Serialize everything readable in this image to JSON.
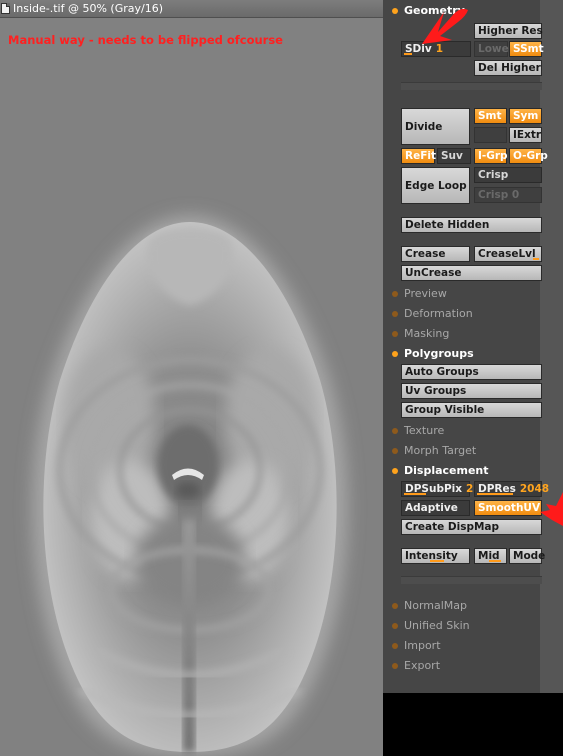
{
  "window": {
    "title": "Inside-.tif @ 50% (Gray/16)",
    "annotation": "Manual way - needs to be flipped ofcourse"
  },
  "palette": {
    "geometry": {
      "header": "Geometry",
      "higher_res": "Higher Res",
      "sdiv_label": "SDiv",
      "sdiv_value": "1",
      "lower_res": "Lower",
      "ssmt": "SSmt",
      "del_higher": "Del Higher",
      "divide": "Divide",
      "smt": "Smt",
      "sym": "Sym",
      "iextr": "IExtr",
      "refit": "ReFit",
      "suv": "Suv",
      "i_grp": "I-Grp",
      "o_grp": "O-Grp",
      "edge_loop": "Edge Loop",
      "crisp": "Crisp",
      "crisp_value": "Crisp 0",
      "delete_hidden": "Delete Hidden",
      "crease": "Crease",
      "crease_lvl": "CreaseLvl",
      "uncrease": "UnCrease"
    },
    "sections_closed_1": [
      "Preview",
      "Deformation",
      "Masking"
    ],
    "polygroups": {
      "header": "Polygroups",
      "auto_groups": "Auto Groups",
      "uv_groups": "Uv Groups",
      "group_visible": "Group Visible"
    },
    "sections_closed_2": [
      "Texture",
      "Morph Target"
    ],
    "displacement": {
      "header": "Displacement",
      "dpsubpix_label": "DPSubPix",
      "dpsubpix_value": "2",
      "dpres_label": "DPRes",
      "dpres_value": "2048",
      "adaptive": "Adaptive",
      "smoothuv": "SmoothUV",
      "create_dispmap": "Create DispMap",
      "intensity": "Intensity",
      "mid": "Mid",
      "mode": "Mode"
    },
    "sections_closed_3": [
      "NormalMap",
      "Unified Skin",
      "Import",
      "Export"
    ]
  },
  "colors": {
    "accent": "#ffa31c",
    "annotation_red": "#ff2020",
    "panel_bg": "#464646",
    "canvas_bg": "#818181"
  },
  "icons": [
    "document-icon",
    "red-arrow-icon"
  ]
}
